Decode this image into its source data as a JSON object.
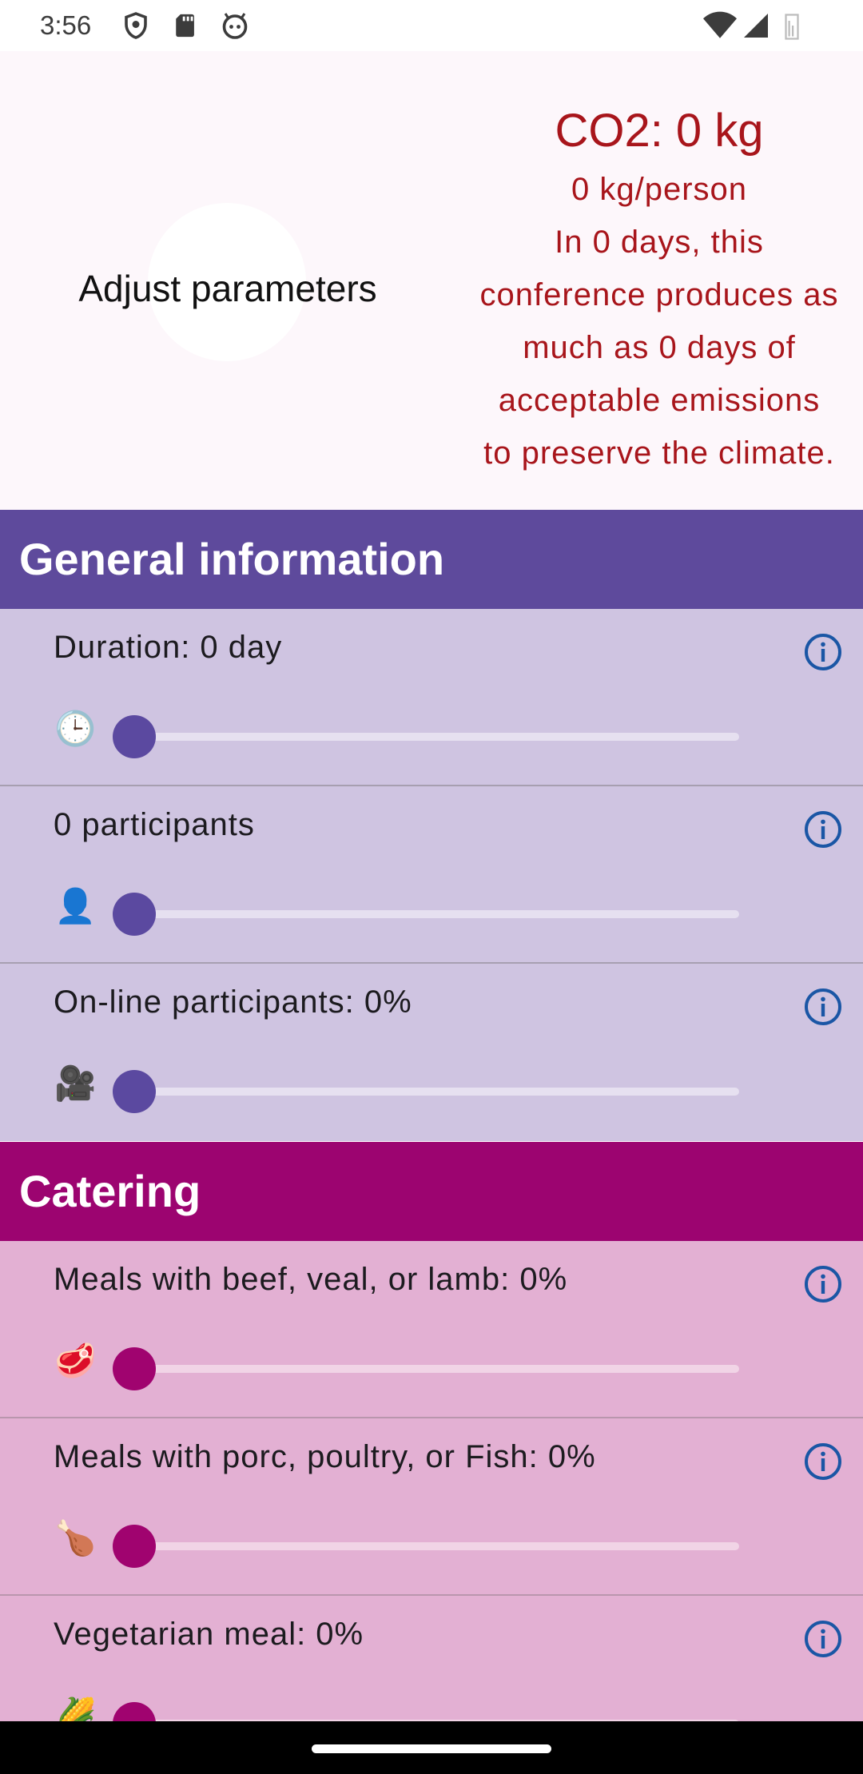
{
  "status_bar": {
    "time": "3:56"
  },
  "header": {
    "adjust_label": "Adjust parameters",
    "co2_total": "CO2: 0 kg",
    "per_person": "0 kg/person",
    "message_lines": [
      "In 0 days, this",
      "conference produces as",
      "much as 0 days of",
      "acceptable emissions",
      "to preserve the climate."
    ]
  },
  "colors": {
    "general_header": "#5e4a9c",
    "general_row": "#cfc4e1",
    "general_accent": "#5b49a0",
    "catering_header": "#9c0470",
    "catering_row": "#e3b0d3",
    "catering_accent": "#a0036f",
    "co2_text": "#a8151b",
    "info_icon": "#1a56a5"
  },
  "sections": {
    "general": {
      "title": "General information",
      "items": [
        {
          "label": "Duration: 0 day",
          "icon": "clock-icon",
          "emoji": "🕒",
          "value_fraction": 0
        },
        {
          "label": "0 participants",
          "icon": "person-icon",
          "emoji": "👤",
          "value_fraction": 0
        },
        {
          "label": "On-line participants: 0%",
          "icon": "video-camera-icon",
          "emoji": "🎥",
          "value_fraction": 0
        }
      ]
    },
    "catering": {
      "title": "Catering",
      "items": [
        {
          "label": "Meals with beef, veal, or lamb: 0%",
          "icon": "meat-icon",
          "emoji": "🥩",
          "value_fraction": 0
        },
        {
          "label": "Meals with porc, poultry, or Fish: 0%",
          "icon": "poultry-leg-icon",
          "emoji": "🍗",
          "value_fraction": 0
        },
        {
          "label": "Vegetarian meal: 0%",
          "icon": "corn-icon",
          "emoji": "🌽",
          "value_fraction": 0
        }
      ]
    }
  }
}
